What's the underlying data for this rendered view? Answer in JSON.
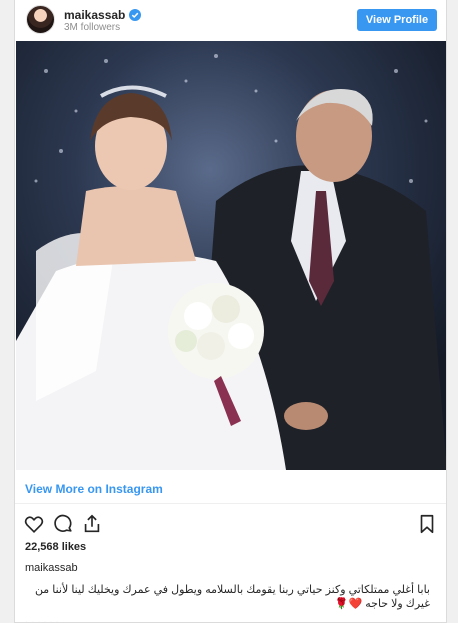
{
  "header": {
    "username": "maikassab",
    "followers": "3M followers",
    "view_profile_label": "View Profile",
    "verified_icon": "verified-badge-icon",
    "accent_color": "#3897f0"
  },
  "post": {
    "photo_icon": "wedding-photo",
    "view_more_label": "View More on Instagram",
    "likes": "22,568 likes",
    "caption_user": "maikassab",
    "caption_line1": "بابا أغلي ممتلكاتي وكنز حياتي ربنا يقومك بالسلامه ويطول في عمرك ويخليك لينا لأننا من",
    "caption_line2": "غيرك ولا حاجه ❤️🌹",
    "comments_hint": "· · · · · ·"
  },
  "actions": {
    "icons": [
      "heart-icon",
      "comment-icon",
      "share-icon",
      "bookmark-icon"
    ]
  }
}
